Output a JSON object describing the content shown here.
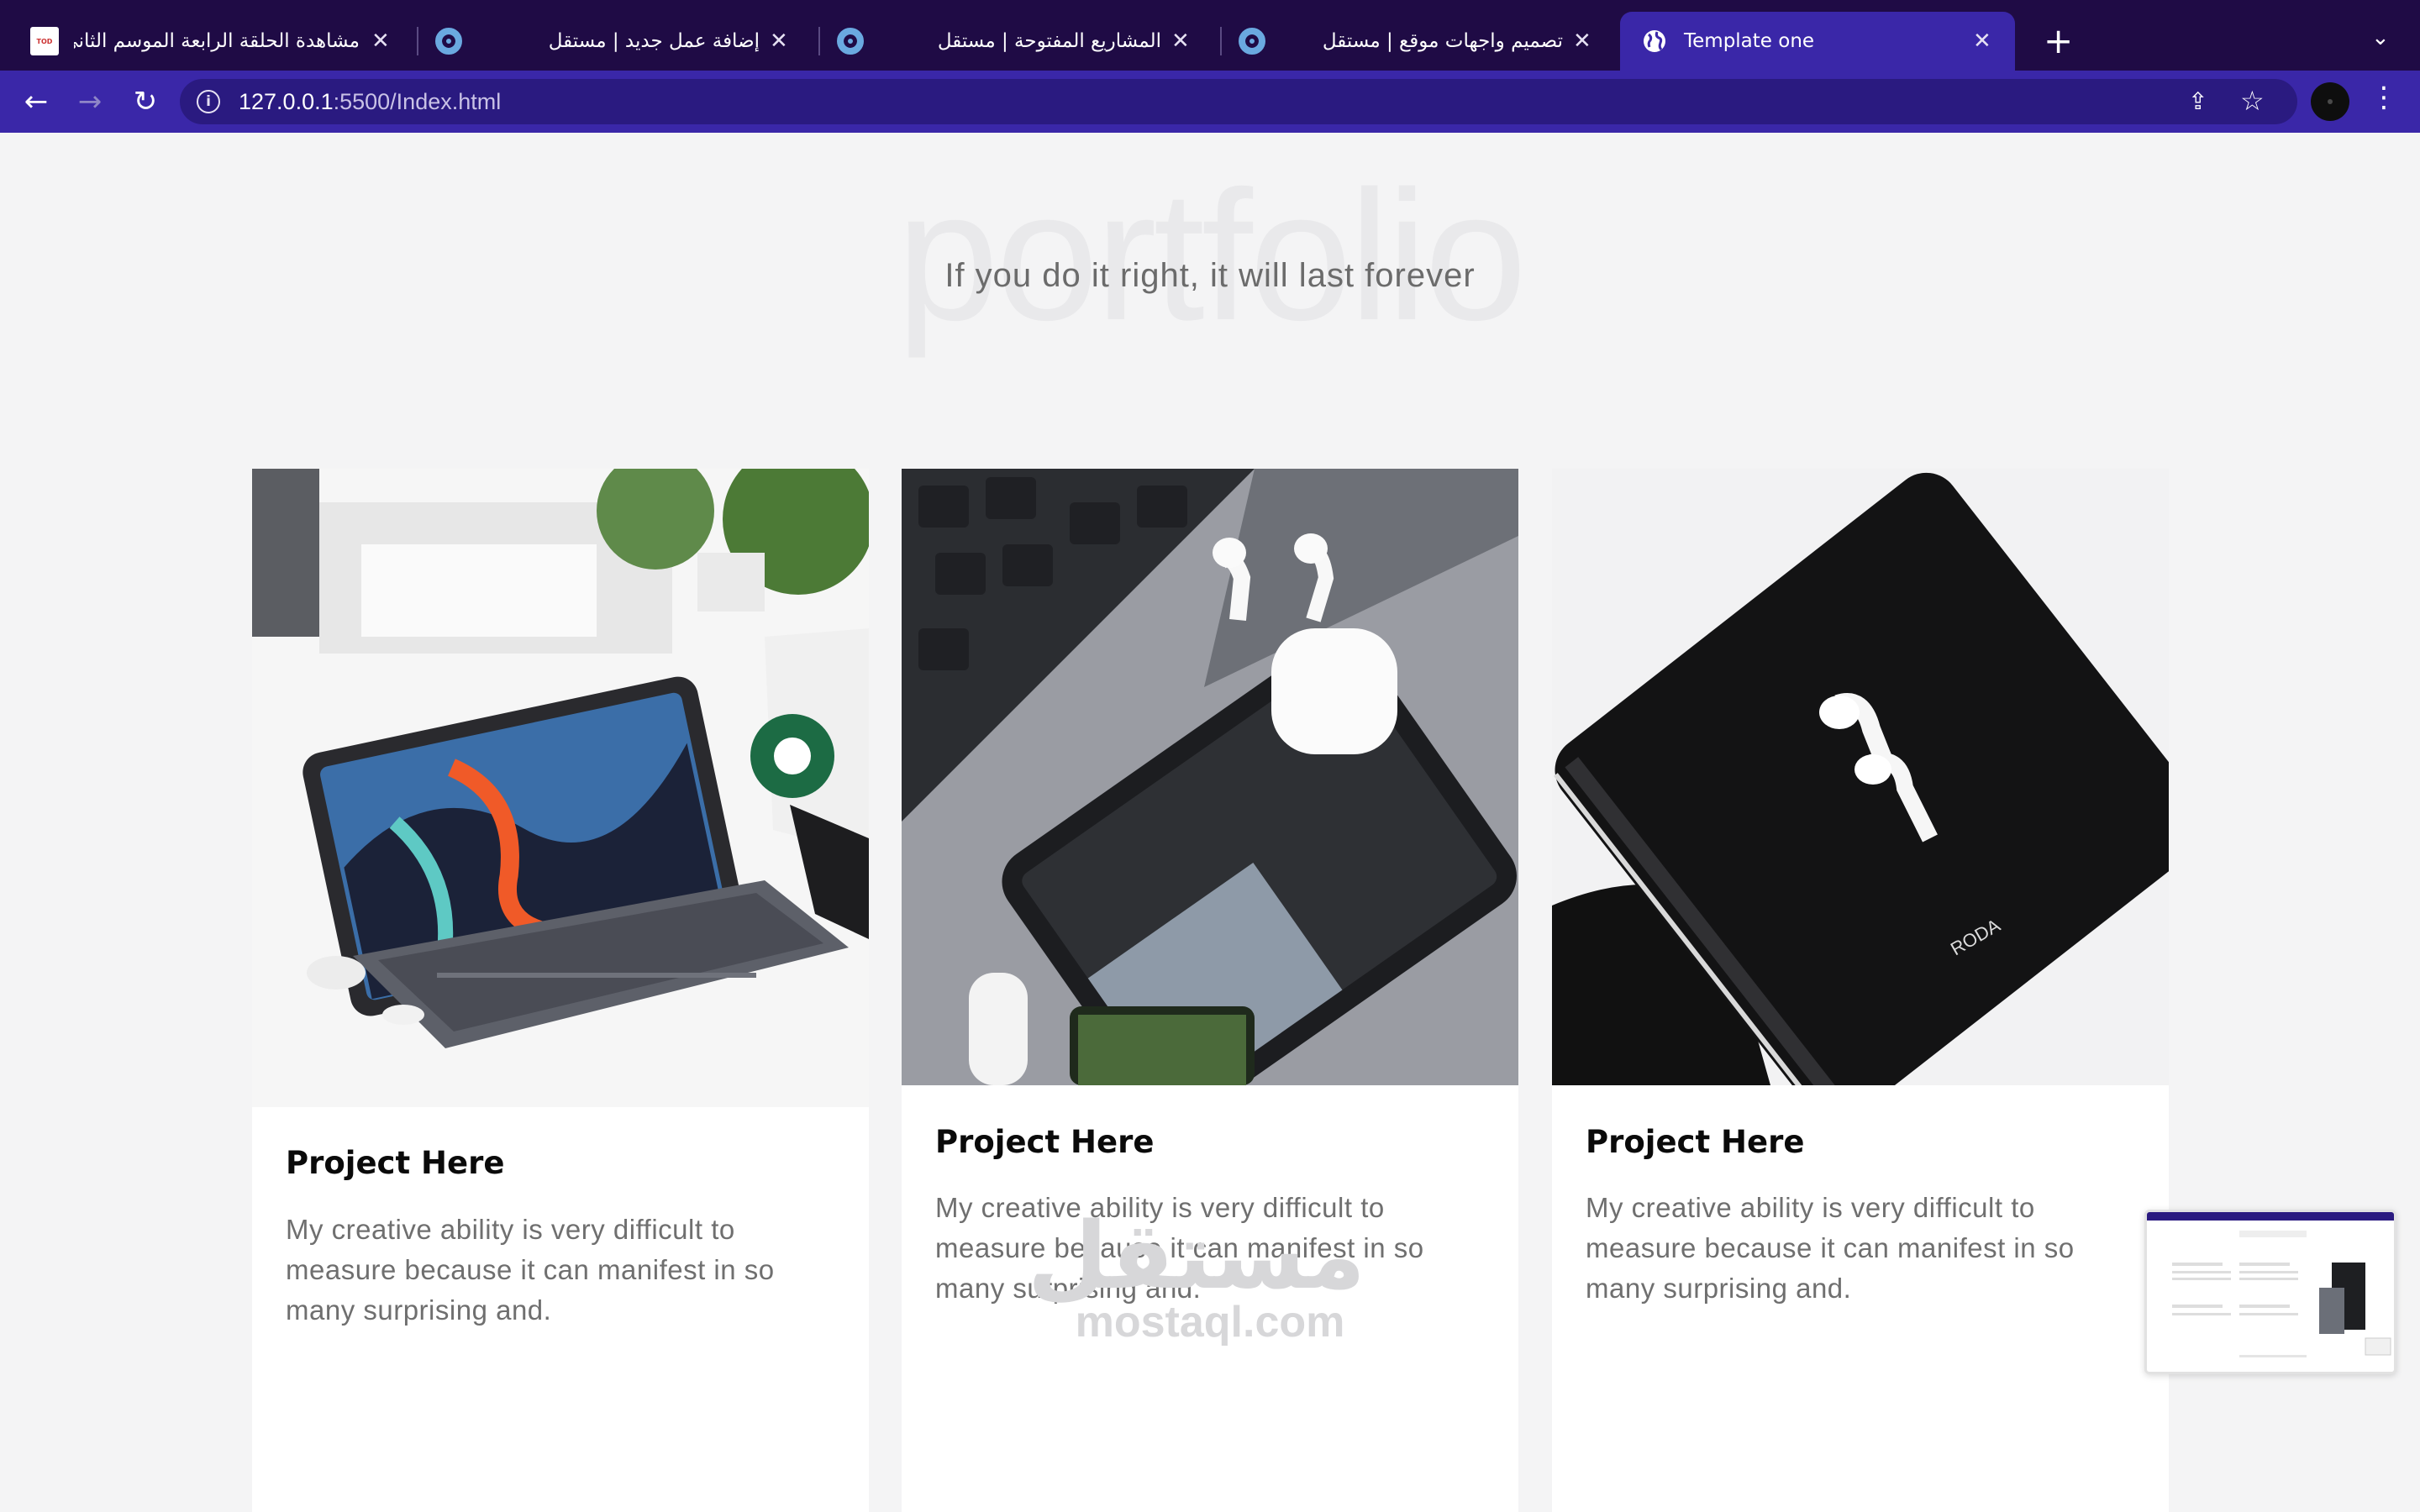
{
  "browser": {
    "tabs": [
      {
        "title": "مشاهدة الحلقة الرابعة الموسم الثانى",
        "favicon": "ext-favicon"
      },
      {
        "title": "إضافة عمل جديد | مستقل",
        "favicon": "mostaql-favicon"
      },
      {
        "title": "المشاريع المفتوحة | مستقل",
        "favicon": "mostaql-favicon"
      },
      {
        "title": "تصميم واجهات موقع | مستقل",
        "favicon": "mostaql-favicon"
      }
    ],
    "active_tab": {
      "title": "Template one",
      "favicon": "globe-icon"
    },
    "url_host": "127.0.0.1",
    "url_rest": ":5500/Index.html",
    "colors": {
      "tabbar": "#1f0b45",
      "toolbar": "#3a27a8",
      "omnibox": "#2a1a80"
    }
  },
  "page": {
    "big_title": "portfolio",
    "subtitle": "If you do it right, it will last forever",
    "cards": [
      {
        "title": "Project Here",
        "text": "My creative ability is very difficult to measure because it can manifest in so many surprising and.",
        "image": "ipad-keyboard-photo"
      },
      {
        "title": "Project Here",
        "text": "My creative ability is very difficult to measure because it can manifest in so many surprising and.",
        "image": "keyboard-airpods-tablet-photo"
      },
      {
        "title": "Project Here",
        "text": "My creative ability is very difficult to measure because it can manifest in so many surprising and.",
        "image": "notebook-airpods-photo"
      }
    ],
    "watermark": {
      "arabic": "مستقل",
      "latin": "mostaql.com"
    }
  }
}
